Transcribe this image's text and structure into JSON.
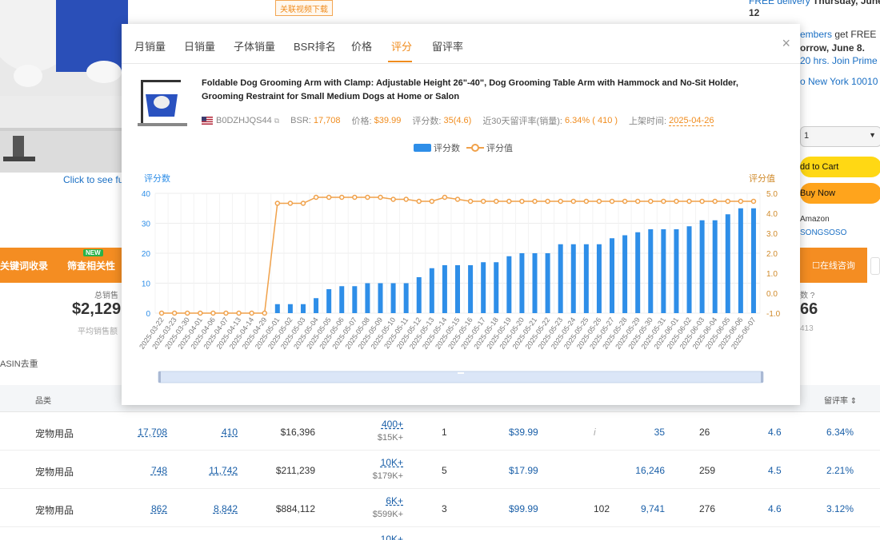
{
  "background": {
    "video_badge": "关联视频下载",
    "click_to_see": "Click to see fu",
    "orange_bar": {
      "keywords_label": "关键词收录",
      "relevance_label": "筛查相关性",
      "new_tag": "NEW"
    },
    "stats": {
      "total_label": "总销售",
      "total_value": "$2,129",
      "total_sub": "平均销售额",
      "right_label": "数",
      "right_value": "66",
      "right_sub": "413"
    },
    "asin_label": "ASIN去重",
    "right_column": {
      "delivery_line": "FREE delivery",
      "delivery_date": "Thursday, June",
      "delivery_day": "12",
      "members_line": "embers",
      "members_suffix": "get FREE",
      "tomorrow": "orrow, June 8.",
      "hours_prefix": "20 hrs.",
      "join_prime": "Join Prime",
      "location": "o New York 10010",
      "qty_value": "1",
      "add_to_cart": "dd to Cart",
      "buy_now": "Buy Now",
      "ships_from": "Amazon",
      "seller": "SONGSOSO",
      "consult": "在线咨询"
    },
    "table": {
      "headers": {
        "category": "品类",
        "retention": "留评率"
      },
      "rows": [
        {
          "category": "宠物用品",
          "bsr": "17,708",
          "sales": "410",
          "revenue": "$16,396",
          "variant_main": "400+",
          "variant_sub": "$15K+",
          "count": "1",
          "price": "$39.99",
          "info": "i",
          "reviews": "35",
          "days": "26",
          "rating": "4.6",
          "rate": "6.34%"
        },
        {
          "category": "宠物用品",
          "bsr": "748",
          "sales": "11,742",
          "revenue": "$211,239",
          "variant_main": "10K+",
          "variant_sub": "$179K+",
          "count": "5",
          "price": "$17.99",
          "info": "",
          "reviews": "16,246",
          "days": "259",
          "rating": "4.5",
          "rate": "2.21%"
        },
        {
          "category": "宠物用品",
          "bsr": "862",
          "sales": "8,842",
          "revenue": "$884,112",
          "variant_main": "6K+",
          "variant_sub": "$599K+",
          "count": "3",
          "price": "$99.99",
          "info": "102",
          "reviews": "9,741",
          "days": "276",
          "rating": "4.6",
          "rate": "3.12%"
        },
        {
          "category": "",
          "bsr": "",
          "sales": "",
          "revenue": "",
          "variant_main": "10K+",
          "variant_sub": "",
          "count": "",
          "price": "",
          "info": "",
          "reviews": "",
          "days": "",
          "rating": "",
          "rate": ""
        }
      ]
    }
  },
  "modal": {
    "tabs": [
      "月销量",
      "日销量",
      "子体销量",
      "BSR排名",
      "价格",
      "评分",
      "留评率"
    ],
    "active_tab": "评分",
    "close_symbol": "×",
    "product": {
      "title": "Foldable Dog Grooming Arm with Clamp: Adjustable Height 26\"-40\", Dog Grooming Table Arm with Hammock and No-Sit Holder, Grooming Restraint for Small Medium Dogs at Home or Salon",
      "asin": "B0DZHJQS44",
      "bsr_label": "BSR:",
      "bsr_value": "17,708",
      "price_label": "价格:",
      "price_value": "$39.99",
      "review_label": "评分数:",
      "review_value": "35(4.6)",
      "rate_label": "近30天留评率(销量):",
      "rate_value": "6.34% ( 410 )",
      "listed_label": "上架时间:",
      "listed_value": "2025-04-26"
    }
  },
  "chart_data": {
    "type": "bar",
    "legend": [
      {
        "name": "评分数",
        "kind": "bar",
        "color": "#2e8ee8"
      },
      {
        "name": "评分值",
        "kind": "line",
        "color": "#f0a14a"
      }
    ],
    "legend_position": "top-center",
    "y_left": {
      "label": "评分数",
      "min": 0,
      "max": 40,
      "ticks": [
        0,
        10,
        20,
        30,
        40
      ],
      "color": "#2e8ee8"
    },
    "y_right": {
      "label": "评分值",
      "min": -1.0,
      "max": 5.0,
      "ticks": [
        -1.0,
        0.0,
        1.0,
        2.0,
        3.0,
        4.0,
        5.0
      ],
      "color": "#f0a14a"
    },
    "grid": true,
    "categories": [
      "2025-03-22",
      "2025-03-23",
      "2025-03-30",
      "2025-04-01",
      "2025-04-06",
      "2025-04-07",
      "2025-04-13",
      "2025-04-14",
      "2025-04-29",
      "2025-05-01",
      "2025-05-02",
      "2025-05-03",
      "2025-05-04",
      "2025-05-05",
      "2025-05-06",
      "2025-05-07",
      "2025-05-08",
      "2025-05-09",
      "2025-05-10",
      "2025-05-11",
      "2025-05-12",
      "2025-05-13",
      "2025-05-14",
      "2025-05-15",
      "2025-05-16",
      "2025-05-17",
      "2025-05-18",
      "2025-05-19",
      "2025-05-20",
      "2025-05-21",
      "2025-05-22",
      "2025-05-23",
      "2025-05-24",
      "2025-05-25",
      "2025-05-26",
      "2025-05-27",
      "2025-05-28",
      "2025-05-29",
      "2025-05-30",
      "2025-05-31",
      "2025-06-01",
      "2025-06-02",
      "2025-06-03",
      "2025-06-04",
      "2025-06-05",
      "2025-06-06",
      "2025-06-07"
    ],
    "series": [
      {
        "name": "评分数",
        "kind": "bar",
        "values": [
          0,
          0,
          0,
          0,
          0,
          0,
          0,
          0,
          0,
          3,
          3,
          3,
          5,
          8,
          9,
          9,
          10,
          10,
          10,
          10,
          12,
          15,
          16,
          16,
          16,
          17,
          17,
          19,
          20,
          20,
          20,
          23,
          23,
          23,
          23,
          25,
          26,
          27,
          28,
          28,
          28,
          29,
          31,
          31,
          33,
          35,
          35
        ]
      },
      {
        "name": "评分值",
        "kind": "line",
        "values": [
          -1.0,
          -1.0,
          -1.0,
          -1.0,
          -1.0,
          -1.0,
          -1.0,
          -1.0,
          -1.0,
          4.5,
          4.5,
          4.5,
          4.8,
          4.8,
          4.8,
          4.8,
          4.8,
          4.8,
          4.7,
          4.7,
          4.6,
          4.6,
          4.8,
          4.7,
          4.6,
          4.6,
          4.6,
          4.6,
          4.6,
          4.6,
          4.6,
          4.6,
          4.6,
          4.6,
          4.6,
          4.6,
          4.6,
          4.6,
          4.6,
          4.6,
          4.6,
          4.6,
          4.6,
          4.6,
          4.6,
          4.6,
          4.6
        ]
      }
    ]
  }
}
